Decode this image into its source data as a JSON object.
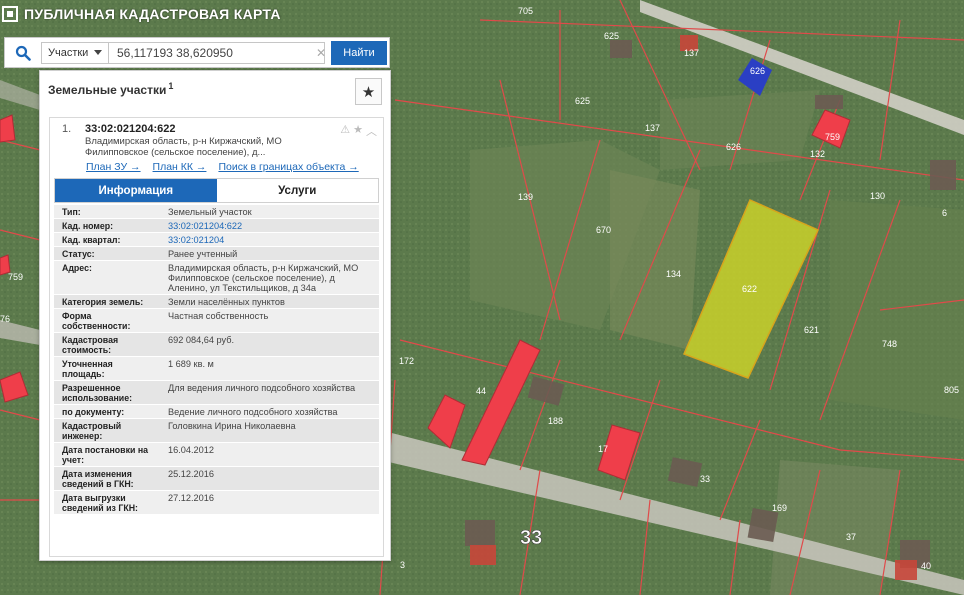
{
  "app": {
    "title": "ПУБЛИЧНАЯ КАДАСТРОВАЯ КАРТА"
  },
  "search": {
    "type_label": "Участки",
    "query": "56,117193 38,620950",
    "button_label": "Найти"
  },
  "panel": {
    "title": "Земельные участки",
    "title_superscript": "1"
  },
  "result": {
    "index": "1.",
    "number": "33:02:021204:622",
    "address_short": "Владимирская область, р-н Киржачский, МО Филипповское (сельское поселение), д...",
    "links": [
      "План ЗУ →",
      "План КК →",
      "Поиск в границах объекта →"
    ]
  },
  "tabs": [
    "Информация",
    "Услуги"
  ],
  "info": [
    {
      "key": "Тип:",
      "value": "Земельный участок"
    },
    {
      "key": "Кад. номер:",
      "value": "33:02:021204:622",
      "link": true
    },
    {
      "key": "Кад. квартал:",
      "value": "33:02:021204",
      "link": true
    },
    {
      "key": "Статус:",
      "value": "Ранее учтенный"
    },
    {
      "key": "Адрес:",
      "value": "Владимирская область, р-н Киржачский, МО Филипповское (сельское поселение), д Аленино, ул Текстильщиков, д 34а"
    },
    {
      "key": "Категория земель:",
      "value": "Земли населённых пунктов"
    },
    {
      "key": "Форма собственности:",
      "value": "Частная собственность"
    },
    {
      "key": "Кадастровая стоимость:",
      "value": "692 084,64 руб."
    },
    {
      "key": "Уточненная площадь:",
      "value": "1 689 кв. м"
    },
    {
      "key": "Разрешенное использование:",
      "value": "Для ведения личного подсобного хозяйства"
    },
    {
      "key": "по документу:",
      "value": "Ведение личного подсобного хозяйства"
    },
    {
      "key": "Кадастровый инженер:",
      "value": "Головкина Ирина Николаевна"
    },
    {
      "key": "Дата постановки на учет:",
      "value": "16.04.2012"
    },
    {
      "key": "Дата изменения сведений в ГКН:",
      "value": "25.12.2016"
    },
    {
      "key": "Дата выгрузки сведений из ГКН:",
      "value": "27.12.2016"
    }
  ],
  "map": {
    "parcel_labels": [
      "705",
      "625",
      "137",
      "626",
      "625",
      "137",
      "626",
      "132",
      "759",
      "130",
      "139",
      "670",
      "134",
      "622",
      "621",
      "748",
      "172",
      "44",
      "188",
      "805",
      "6",
      "759",
      "76",
      "17",
      "33",
      "169",
      "37",
      "40",
      "3"
    ],
    "road_label": "33",
    "selected_parcel": "622",
    "selected_fill": "#c9d12a",
    "boundary_color": "#e04a4a",
    "building_color": "#ef3e4a"
  }
}
